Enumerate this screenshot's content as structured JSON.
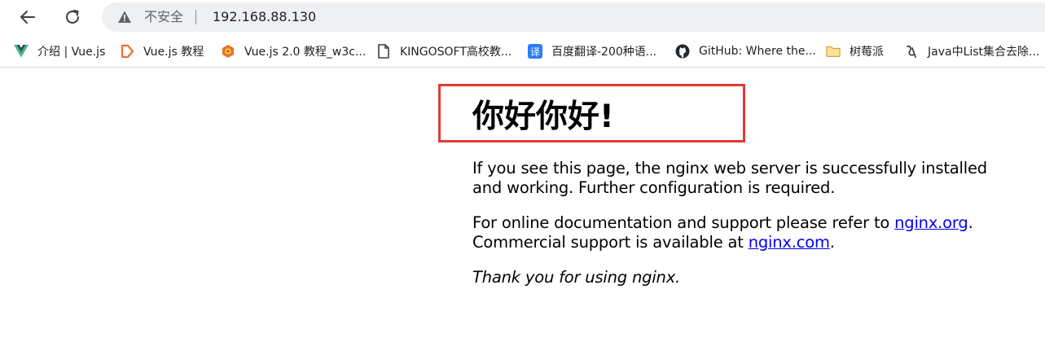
{
  "browser": {
    "security_label": "不安全",
    "url": "192.168.88.130",
    "icons": {
      "back": "arrow-left-icon",
      "reload": "reload-icon",
      "security": "warning-triangle-icon"
    }
  },
  "bookmarks": [
    {
      "label": "介绍 | Vue.js",
      "icon": "vue-logo-icon"
    },
    {
      "label": "Vue.js 教程",
      "icon": "runoob-logo-icon"
    },
    {
      "label": "Vue.js 2.0 教程_w3c...",
      "icon": "w3c-logo-icon"
    },
    {
      "label": "KINGOSOFT高校教...",
      "icon": "document-icon"
    },
    {
      "label": "百度翻译-200种语...",
      "icon": "baidu-translate-icon"
    },
    {
      "label": "GitHub: Where the...",
      "icon": "github-icon"
    },
    {
      "label": "树莓派",
      "icon": "folder-icon"
    },
    {
      "label": "Java中List集合去除...",
      "icon": "site-logo-icon"
    }
  ],
  "page": {
    "title": "你好你好!",
    "p1": "If you see this page, the nginx web server is successfully installed and working. Further configuration is required.",
    "p2_prefix": "For online documentation and support please refer to ",
    "p2_link1": "nginx.org",
    "p2_mid": ".",
    "p2_line2_prefix": "Commercial support is available at ",
    "p2_link2": "nginx.com",
    "p2_end": ".",
    "p3": "Thank you for using nginx."
  },
  "colors": {
    "highlight_border": "#e53935",
    "link": "#0000ee",
    "omnibox_bg": "#eef0f2"
  }
}
